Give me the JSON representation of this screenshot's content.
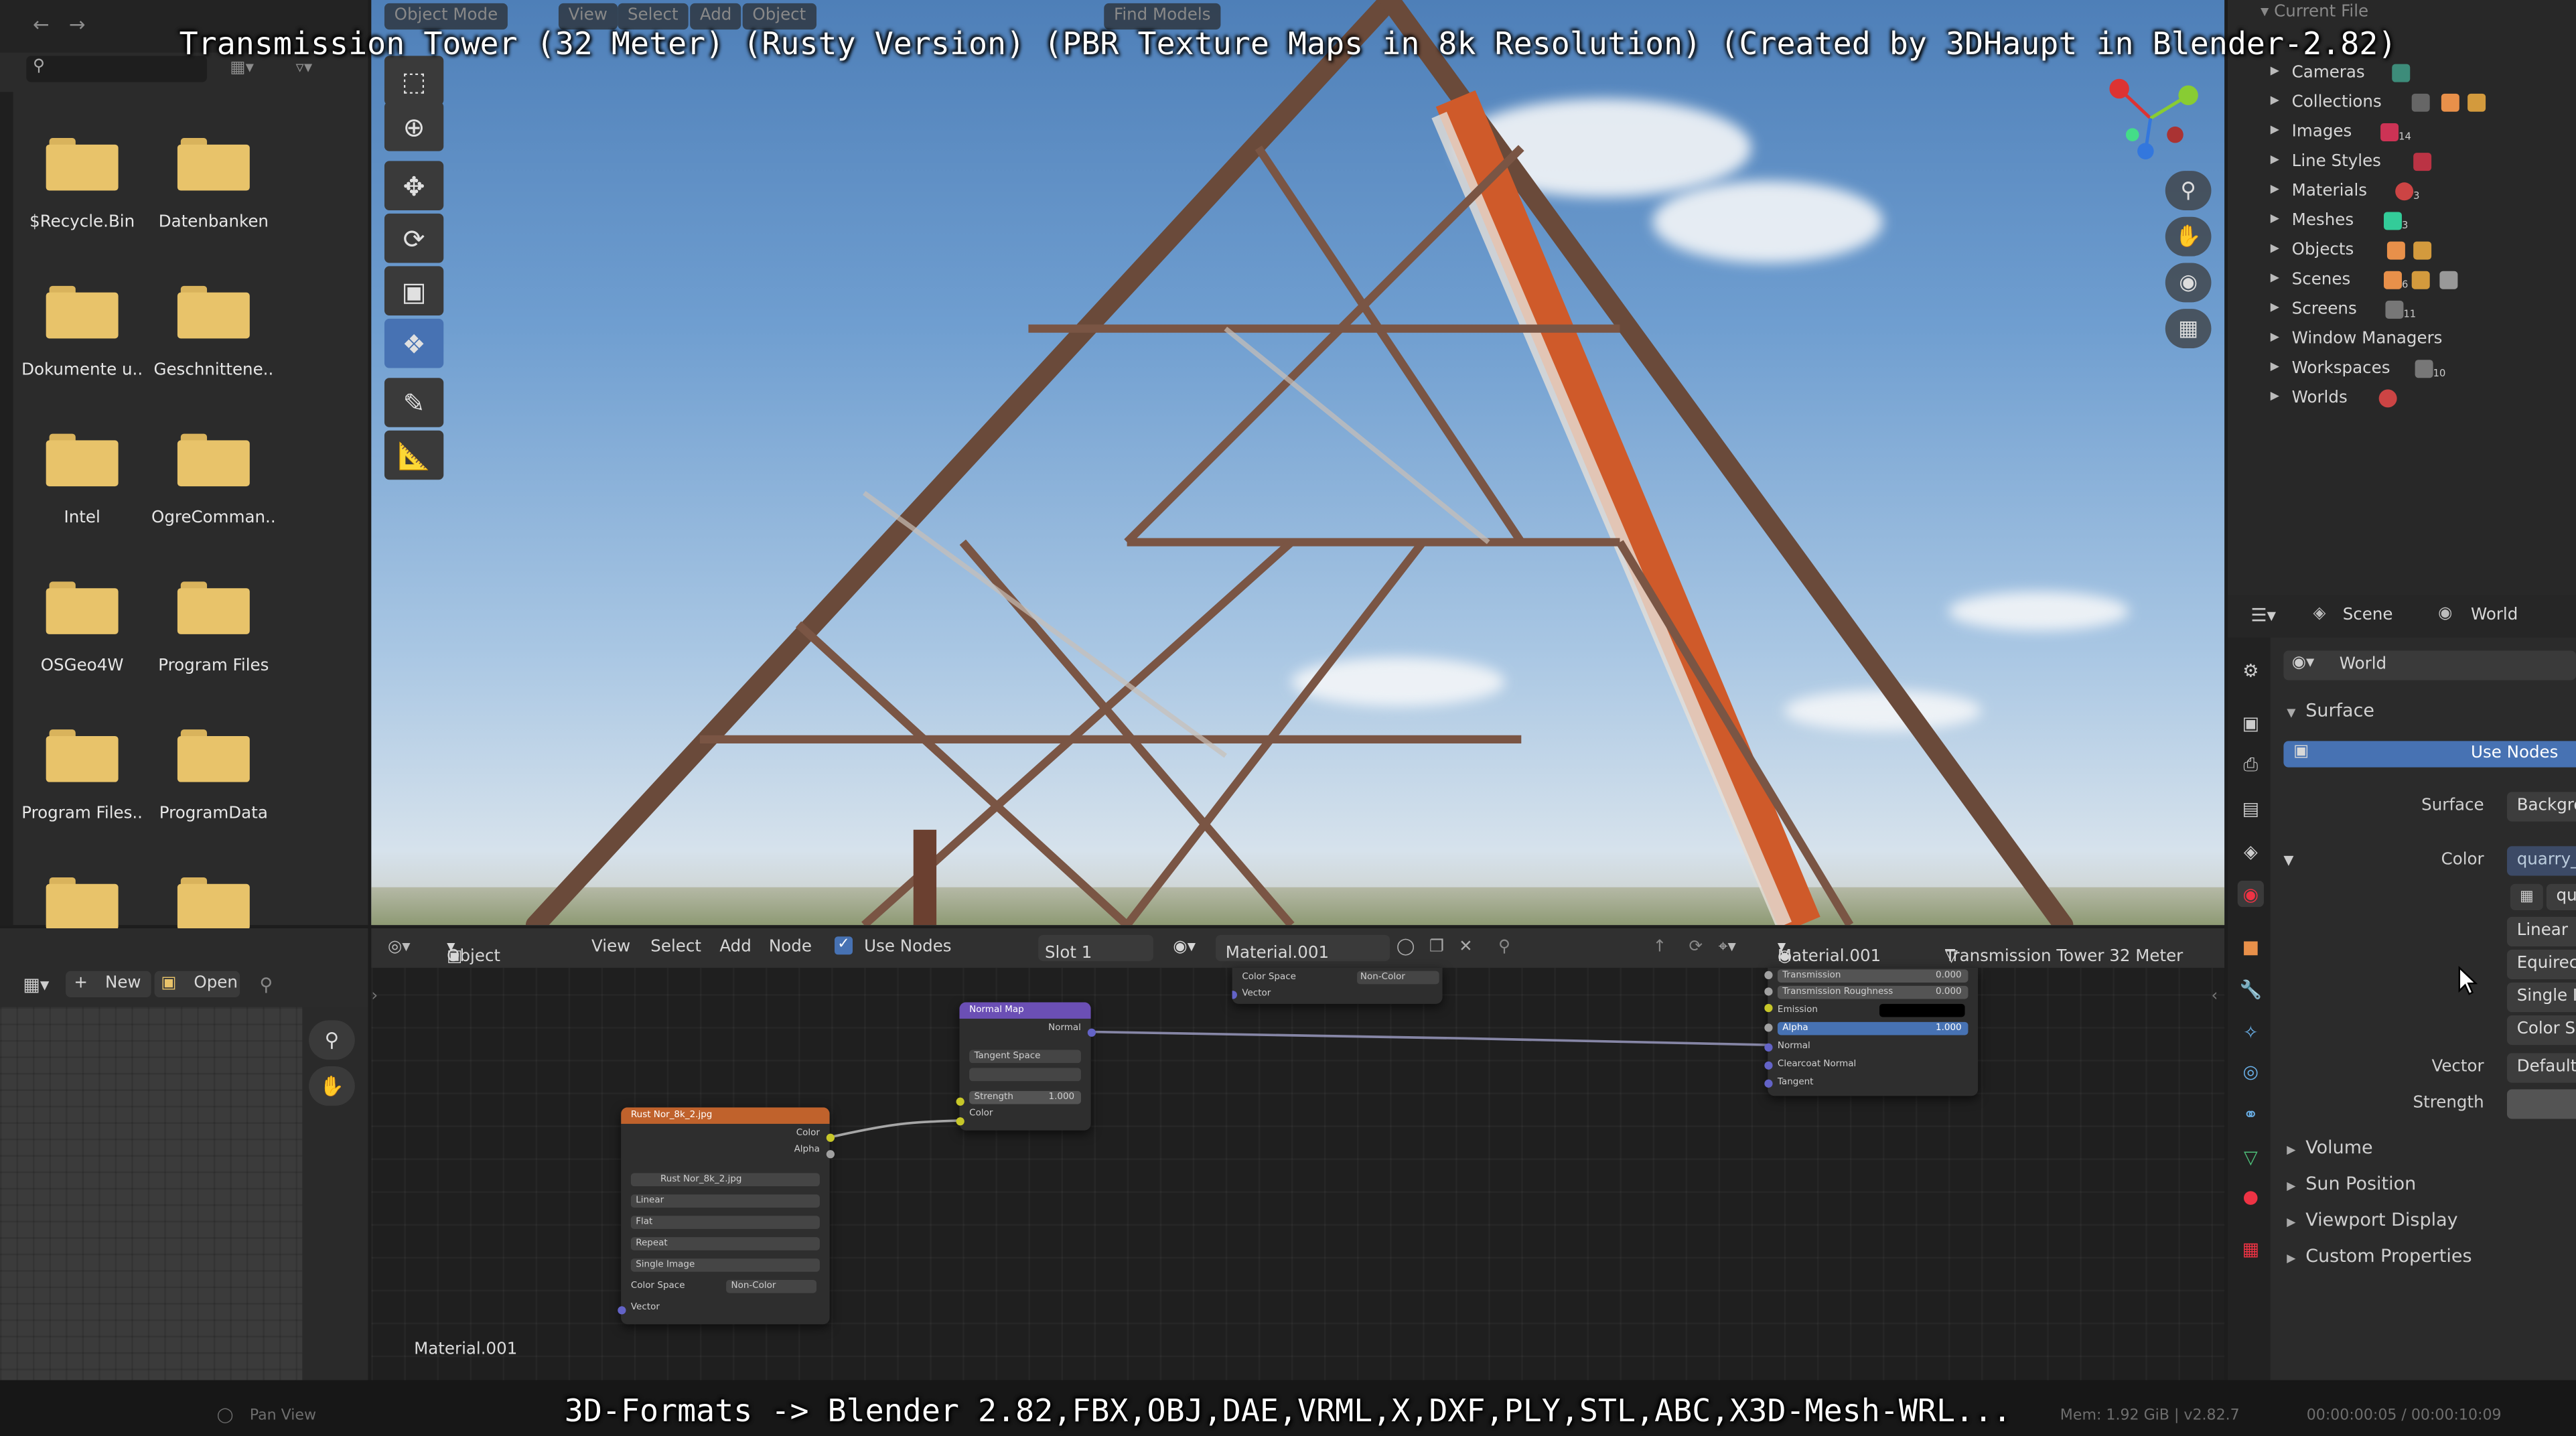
{
  "overlay": {
    "title": "Transmission Tower (32 Meter) (Rusty Version) (PBR Texture Maps in 8k Resolution) (Created by 3DHaupt in Blender-2.82)",
    "subtitle": "3D-Formats -> Blender 2.82,FBX,OBJ,DAE,VRML,X,DXF,PLY,STL,ABC,X3D-Mesh-WRL..."
  },
  "viewport_header": {
    "mode": "Object Mode",
    "menus": [
      "View",
      "Select",
      "Add",
      "Object"
    ],
    "find_models": "Find Models"
  },
  "file_browser": {
    "folders": [
      "$Recycle.Bin",
      "Datenbanken",
      "Dokumente u..",
      "Geschnittene..",
      "Intel",
      "OgreComman..",
      "OSGeo4W",
      "Program Files",
      "Program Files..",
      "ProgramData",
      "",
      ""
    ]
  },
  "outliner": {
    "header": "Current File",
    "items": [
      {
        "label": "Cameras"
      },
      {
        "label": "Collections"
      },
      {
        "label": "Images",
        "count": "14"
      },
      {
        "label": "Line Styles"
      },
      {
        "label": "Materials",
        "count": "3"
      },
      {
        "label": "Meshes",
        "count": "3"
      },
      {
        "label": "Objects"
      },
      {
        "label": "Scenes",
        "count": "6"
      },
      {
        "label": "Screens",
        "count": "11"
      },
      {
        "label": "Window Managers"
      },
      {
        "label": "Workspaces",
        "count": "10"
      },
      {
        "label": "Worlds"
      }
    ]
  },
  "properties": {
    "breadcrumb_scene": "Scene",
    "breadcrumb_world": "World",
    "world_name": "World",
    "surface_section": "Surface",
    "use_nodes_btn": "Use Nodes",
    "surface_label": "Surface",
    "surface_value": "Backgro",
    "color_label": "Color",
    "color_value": "quarry_",
    "image_name": "qu",
    "interp": "Linear",
    "projection": "Equirec",
    "source": "Single I",
    "color_space": "Color Sp",
    "vector_label": "Vector",
    "vector_value": "Default",
    "strength_label": "Strength",
    "sections": [
      "Volume",
      "Sun Position",
      "Viewport Display",
      "Custom Properties"
    ]
  },
  "node_editor": {
    "header": {
      "object": "Object",
      "view": "View",
      "select": "Select",
      "add": "Add",
      "node": "Node",
      "use_nodes": "Use Nodes",
      "slot": "Slot 1",
      "material": "Material.001",
      "material_right": "Material.001",
      "object_name": "Transmission Tower 32 Meter"
    },
    "material_label": "Material.001",
    "image_node": {
      "title": "Rust Nor_8k_2.jpg",
      "out_color": "Color",
      "out_alpha": "Alpha",
      "file": "Rust Nor_8k_2.jpg",
      "interp": "Linear",
      "proj": "Flat",
      "ext": "Repeat",
      "source": "Single Image",
      "cs_label": "Color Space",
      "cs_value": "Non-Color",
      "vector": "Vector"
    },
    "normal_node": {
      "title": "Normal Map",
      "out": "Normal",
      "space": "Tangent Space",
      "strength_label": "Strength",
      "strength_value": "1.000",
      "color": "Color"
    },
    "top_node": {
      "cs_label": "Color Space",
      "cs_value": "Non-Color",
      "vector": "Vector"
    },
    "bsdf_node": {
      "transmission": "Transmission",
      "transmission_val": "0.000",
      "trans_rough": "Transmission Roughness",
      "trans_rough_val": "0.000",
      "emission": "Emission",
      "alpha": "Alpha",
      "alpha_val": "1.000",
      "normal": "Normal",
      "clearcoat_normal": "Clearcoat Normal",
      "tangent": "Tangent"
    }
  },
  "image_editor": {
    "new": "New",
    "open": "Open"
  },
  "status": {
    "pan": "Pan View",
    "mem": "Mem: 1.92 GiB | v2.82.7",
    "time": "00:00:00:05 / 00:00:10:09"
  },
  "colors": {
    "accent": "#4772b3",
    "image_node_header": "#c0622c",
    "normal_node_header": "#6b4fb5",
    "folder": "#e8c36a"
  }
}
